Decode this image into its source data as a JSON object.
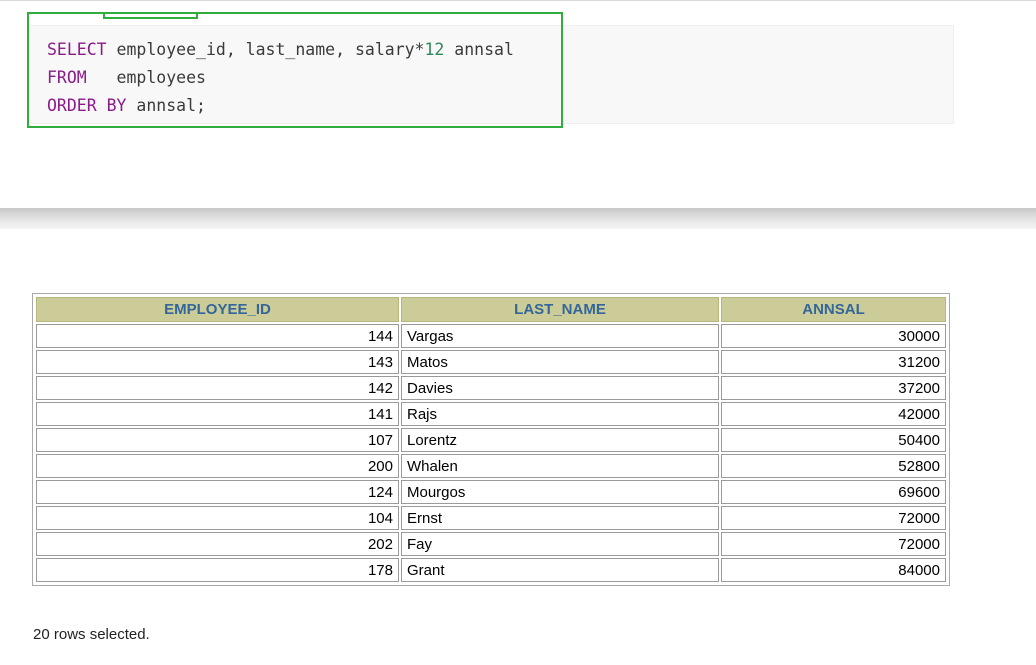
{
  "sql": {
    "line1": {
      "kw": "SELECT",
      "cols_a": " employee_id, last_name, salary*",
      "num": "12",
      "cols_b": " annsal"
    },
    "line2": {
      "kw": "FROM",
      "rest": "   employees"
    },
    "line3": {
      "kw": "ORDER BY",
      "rest": " annsal;"
    }
  },
  "table": {
    "headers": [
      "EMPLOYEE_ID",
      "LAST_NAME",
      "ANNSAL"
    ],
    "rows": [
      [
        "144",
        "Vargas",
        "30000"
      ],
      [
        "143",
        "Matos",
        "31200"
      ],
      [
        "142",
        "Davies",
        "37200"
      ],
      [
        "141",
        "Rajs",
        "42000"
      ],
      [
        "107",
        "Lorentz",
        "50400"
      ],
      [
        "200",
        "Whalen",
        "52800"
      ],
      [
        "124",
        "Mourgos",
        "69600"
      ],
      [
        "104",
        "Ernst",
        "72000"
      ],
      [
        "202",
        "Fay",
        "72000"
      ],
      [
        "178",
        "Grant",
        "84000"
      ]
    ]
  },
  "footer": {
    "status": "20 rows selected."
  },
  "colors": {
    "highlight": "#2fae3c",
    "keyword": "#8b1a8b",
    "header_bg": "#cccc99",
    "header_text": "#336699"
  }
}
